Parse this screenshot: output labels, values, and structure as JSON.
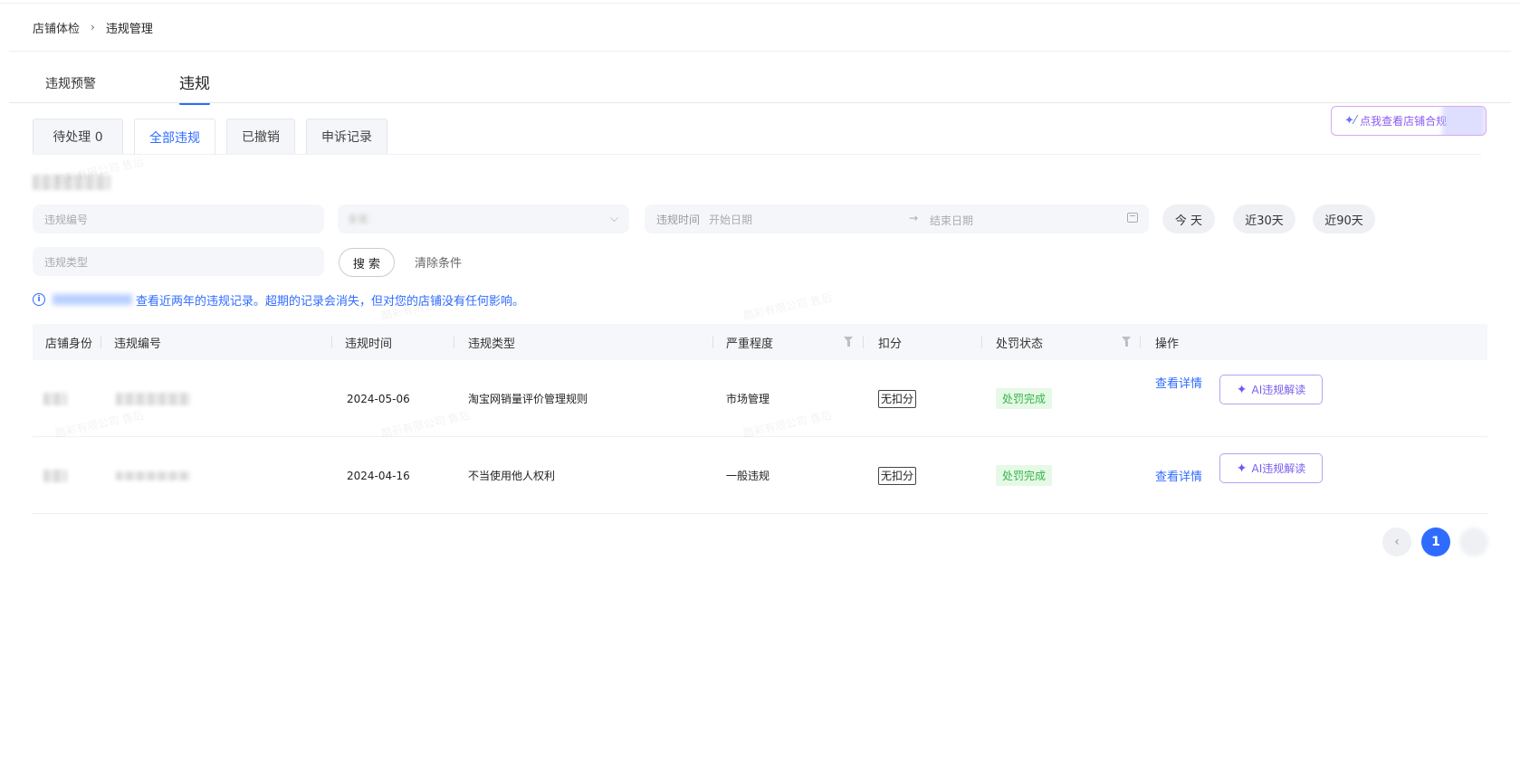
{
  "breadcrumb": {
    "parent": "店铺体检",
    "separator": "›",
    "current": "违规管理"
  },
  "main_tabs": [
    {
      "label": "违规预警"
    },
    {
      "label": "违规",
      "active": true
    }
  ],
  "ai_top_button": {
    "label": "点我查看店铺合规"
  },
  "sub_tabs": [
    {
      "label": "待处理 0"
    },
    {
      "label": "全部违规",
      "active": true
    },
    {
      "label": "已撤销"
    },
    {
      "label": "申诉记录"
    }
  ],
  "filters": {
    "code_placeholder": "违规编号",
    "time_label": "违规时间",
    "start_placeholder": "开始日期",
    "end_placeholder": "结束日期",
    "range_arrow": "→",
    "type_placeholder": "违规类型",
    "quick_ranges": [
      "今 天",
      "近30天",
      "近90天"
    ],
    "search_label": "搜 索",
    "clear_label": "清除条件"
  },
  "info": {
    "icon": "i",
    "text": "查看近两年的违规记录。超期的记录会消失，但对您的店铺没有任何影响。"
  },
  "table": {
    "columns": [
      "店铺身份",
      "违规编号",
      "违规时间",
      "违规类型",
      "严重程度",
      "扣分",
      "处罚状态",
      "操作"
    ],
    "rows": [
      {
        "time": "2024-05-06",
        "type": "淘宝网销量评价管理规则",
        "severity": "市场管理",
        "points": "无扣分",
        "status": "处罚完成",
        "detail": "查看详情",
        "ai": "AI违规解读"
      },
      {
        "time": "2024-04-16",
        "type": "不当使用他人权利",
        "severity": "一般违规",
        "points": "无扣分",
        "status": "处罚完成",
        "detail": "查看详情",
        "ai": "AI违规解读"
      }
    ]
  },
  "pagination": {
    "prev": "‹",
    "current": "1"
  },
  "watermark": "酷彩有限公司 售后",
  "colors": {
    "accent": "#2f6bff",
    "success": "#34b34a",
    "ai_purple": "#7a5cf0"
  }
}
